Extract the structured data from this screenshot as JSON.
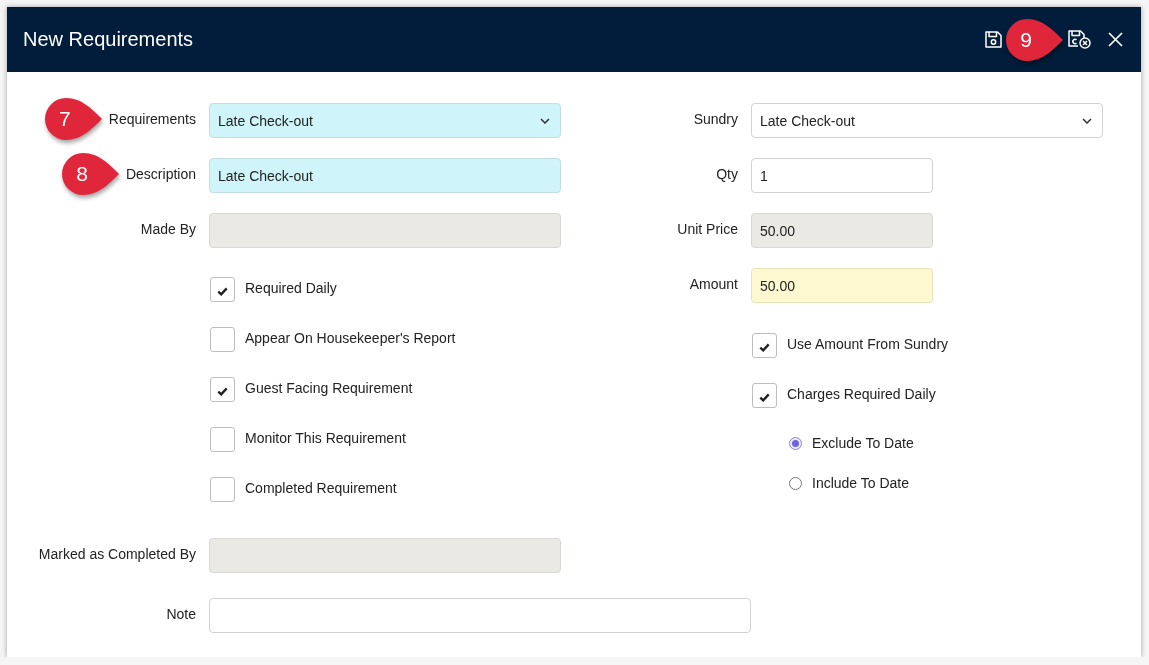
{
  "window": {
    "title": "New Requirements",
    "actions": [
      {
        "kind": "save"
      },
      {
        "kind": "save_close",
        "callout": "9"
      },
      {
        "kind": "close"
      }
    ]
  },
  "form": {
    "left_fields": [
      {
        "label": "Requirements",
        "kind": "select",
        "required": true,
        "disabled": false,
        "highlighted": false,
        "value": "Late Check-out",
        "callout": "7"
      },
      {
        "label": "Description",
        "kind": "text",
        "required": true,
        "disabled": false,
        "highlighted": false,
        "value": "Late Check-out",
        "callout": "8"
      },
      {
        "label": "Made By",
        "kind": "text",
        "required": false,
        "disabled": true,
        "highlighted": false
      }
    ],
    "left_checks": [
      {
        "label": "Required Daily",
        "checked": true
      },
      {
        "label": "Appear On Housekeeper's Report",
        "checked": false
      },
      {
        "label": "Guest Facing Requirement",
        "checked": true
      },
      {
        "label": "Monitor This Requirement",
        "checked": false
      },
      {
        "label": "Completed Requirement",
        "checked": false
      }
    ],
    "right_fields": [
      {
        "label": "Sundry",
        "kind": "select",
        "required": false,
        "disabled": false,
        "highlighted": false,
        "value": "Late Check-out"
      },
      {
        "label": "Qty",
        "kind": "number",
        "required": false,
        "disabled": false,
        "highlighted": false,
        "value": "1"
      },
      {
        "label": "Unit Price",
        "kind": "number",
        "required": false,
        "disabled": true,
        "highlighted": false,
        "value": "50.00"
      },
      {
        "label": "Amount",
        "kind": "number",
        "required": false,
        "disabled": false,
        "highlighted": true,
        "value": "50.00"
      }
    ],
    "right_checks": [
      {
        "label": "Use Amount From Sundry",
        "checked": true
      },
      {
        "label": "Charges Required Daily",
        "checked": true
      }
    ],
    "date_options": [
      {
        "label": "Exclude To Date",
        "selected": true
      },
      {
        "label": "Include To Date",
        "selected": false
      }
    ],
    "bottom_fields": [
      {
        "label": "Marked as Completed By",
        "kind": "text",
        "required": false,
        "disabled": true,
        "highlighted": false
      },
      {
        "label": "Note",
        "kind": "note",
        "required": false,
        "disabled": false,
        "highlighted": false
      }
    ]
  }
}
